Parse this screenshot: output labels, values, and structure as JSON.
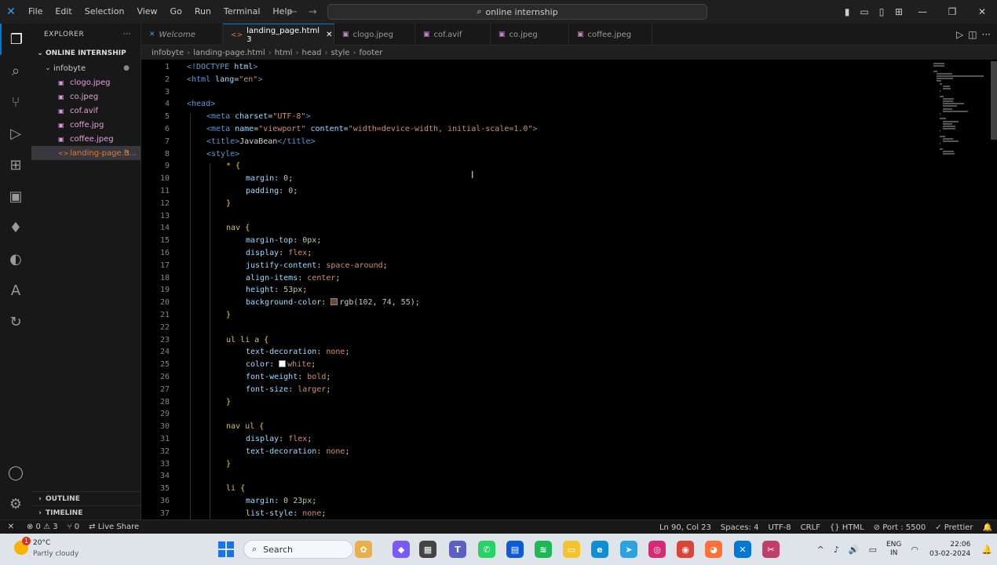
{
  "titlebar": {
    "menu": [
      "File",
      "Edit",
      "Selection",
      "View",
      "Go",
      "Run",
      "Terminal",
      "Help"
    ],
    "search_text": "online internship",
    "logo_glyph": "✕",
    "search_glyph": "⌕",
    "back_glyph": "←",
    "forward_glyph": "→",
    "layout_glyphs": [
      "▮",
      "▭",
      "▯",
      "⊞"
    ],
    "minimize_glyph": "—",
    "restore_glyph": "❐",
    "close_glyph": "✕"
  },
  "activity": {
    "icons": [
      "files-icon",
      "search-icon",
      "source-control-icon",
      "run-debug-icon",
      "extensions-icon",
      "remote-explorer-icon",
      "mongodb-icon",
      "edge-devtools-icon",
      "azure-icon",
      "live-share-icon",
      "accounts-icon",
      "manage-gear-icon"
    ],
    "glyphs": [
      "❐",
      "⌕",
      "⑂",
      "▷",
      "⊞",
      "▣",
      "♦",
      "◐",
      "A",
      "↻",
      "◯",
      "⚙"
    ]
  },
  "sidebar": {
    "header": "EXPLORER",
    "header_more": "···",
    "workspace": "ONLINE INTERNSHIP",
    "folder": "infobyte",
    "folder_dot": "●",
    "chev_open": "⌄",
    "chev_closed": "›",
    "files": [
      {
        "name": "clogo.jpeg",
        "icon": "▣"
      },
      {
        "name": "co.jpeg",
        "icon": "▣"
      },
      {
        "name": "cof.avif",
        "icon": "▣"
      },
      {
        "name": "coffe.jpg",
        "icon": "▣"
      },
      {
        "name": "coffee.jpeg",
        "icon": "▣"
      },
      {
        "name": "landing-page.h...",
        "icon": "<>",
        "badge": "3"
      }
    ],
    "outline": "OUTLINE",
    "timeline": "TIMELINE"
  },
  "tabs": [
    {
      "label": "Welcome",
      "icon": "✕"
    },
    {
      "label": "landing_page.html 3",
      "icon": "<>",
      "close": "✕"
    },
    {
      "label": "clogo.jpeg",
      "icon": "▣"
    },
    {
      "label": "cof.avif",
      "icon": "▣"
    },
    {
      "label": "co.jpeg",
      "icon": "▣"
    },
    {
      "label": "coffee.jpeg",
      "icon": "▣"
    }
  ],
  "tab_actions": {
    "run": "▷",
    "split": "◫",
    "more": "···"
  },
  "breadcrumb": {
    "items": [
      "infobyte",
      "landing-page.html",
      "html",
      "head",
      "style",
      "footer"
    ],
    "sep": "›"
  },
  "editor": {
    "lines": [
      {
        "n": "1",
        "tokens": [
          [
            "tag",
            "<!DOCTYPE "
          ],
          [
            "attr",
            "html"
          ],
          [
            "tag",
            ">"
          ]
        ]
      },
      {
        "n": "2",
        "tokens": [
          [
            "tag",
            "<html "
          ],
          [
            "attr",
            "lang"
          ],
          [
            "txt",
            "="
          ],
          [
            "str",
            "\"en\""
          ],
          [
            "tag",
            ">"
          ]
        ]
      },
      {
        "n": "3",
        "tokens": []
      },
      {
        "n": "4",
        "tokens": [
          [
            "tag",
            "<head>"
          ]
        ]
      },
      {
        "n": "5",
        "indent": 1,
        "tokens": [
          [
            "tag",
            "<meta "
          ],
          [
            "attr",
            "charset"
          ],
          [
            "txt",
            "="
          ],
          [
            "str",
            "\"UTF-8\""
          ],
          [
            "tag",
            ">"
          ]
        ]
      },
      {
        "n": "6",
        "indent": 1,
        "tokens": [
          [
            "tag",
            "<meta "
          ],
          [
            "attr",
            "name"
          ],
          [
            "txt",
            "="
          ],
          [
            "str",
            "\"viewport\" "
          ],
          [
            "attr",
            "content"
          ],
          [
            "txt",
            "="
          ],
          [
            "str",
            "\"width=device-width, initial-scale=1.0\""
          ],
          [
            "tag",
            ">"
          ]
        ]
      },
      {
        "n": "7",
        "indent": 1,
        "tokens": [
          [
            "tag",
            "<title>"
          ],
          [
            "txt",
            "JavaBean"
          ],
          [
            "tag",
            "</title>"
          ]
        ]
      },
      {
        "n": "8",
        "indent": 1,
        "tokens": [
          [
            "tag",
            "<style>"
          ]
        ]
      },
      {
        "n": "9",
        "indent": 2,
        "tokens": [
          [
            "sel",
            "* "
          ],
          [
            "brace",
            "{"
          ]
        ]
      },
      {
        "n": "10",
        "indent": 3,
        "tokens": [
          [
            "prop",
            "margin"
          ],
          [
            "txt",
            ": "
          ],
          [
            "num",
            "0"
          ],
          [
            "txt",
            ";"
          ]
        ]
      },
      {
        "n": "11",
        "indent": 3,
        "tokens": [
          [
            "prop",
            "padding"
          ],
          [
            "txt",
            ": "
          ],
          [
            "num",
            "0"
          ],
          [
            "txt",
            ";"
          ]
        ]
      },
      {
        "n": "12",
        "indent": 2,
        "tokens": [
          [
            "brace",
            "}"
          ]
        ]
      },
      {
        "n": "13",
        "tokens": []
      },
      {
        "n": "14",
        "indent": 2,
        "tokens": [
          [
            "sel",
            "nav "
          ],
          [
            "brace",
            "{"
          ]
        ]
      },
      {
        "n": "15",
        "indent": 3,
        "tokens": [
          [
            "prop",
            "margin-top"
          ],
          [
            "txt",
            ": "
          ],
          [
            "num",
            "0px"
          ],
          [
            "txt",
            ";"
          ]
        ]
      },
      {
        "n": "16",
        "indent": 3,
        "tokens": [
          [
            "prop",
            "display"
          ],
          [
            "txt",
            ": "
          ],
          [
            "val",
            "flex"
          ],
          [
            "txt",
            ";"
          ]
        ]
      },
      {
        "n": "17",
        "indent": 3,
        "tokens": [
          [
            "prop",
            "justify-content"
          ],
          [
            "txt",
            ": "
          ],
          [
            "val",
            "space-around"
          ],
          [
            "txt",
            ";"
          ]
        ]
      },
      {
        "n": "18",
        "indent": 3,
        "tokens": [
          [
            "prop",
            "align-items"
          ],
          [
            "txt",
            ": "
          ],
          [
            "val",
            "center"
          ],
          [
            "txt",
            ";"
          ]
        ]
      },
      {
        "n": "19",
        "indent": 3,
        "tokens": [
          [
            "prop",
            "height"
          ],
          [
            "txt",
            ": "
          ],
          [
            "num",
            "53px"
          ],
          [
            "txt",
            ";"
          ]
        ]
      },
      {
        "n": "20",
        "indent": 3,
        "swatch": "#664a37",
        "tokens": [
          [
            "prop",
            "background-color"
          ],
          [
            "txt",
            ": "
          ],
          [
            "swatch",
            ""
          ],
          [
            "txt",
            "rgb("
          ],
          [
            "num",
            "102"
          ],
          [
            "txt",
            ", "
          ],
          [
            "num",
            "74"
          ],
          [
            "txt",
            ", "
          ],
          [
            "num",
            "55"
          ],
          [
            "txt",
            ");"
          ]
        ]
      },
      {
        "n": "21",
        "indent": 2,
        "tokens": [
          [
            "brace",
            "}"
          ]
        ]
      },
      {
        "n": "22",
        "tokens": []
      },
      {
        "n": "23",
        "indent": 2,
        "tokens": [
          [
            "sel",
            "ul li a "
          ],
          [
            "brace",
            "{"
          ]
        ]
      },
      {
        "n": "24",
        "indent": 3,
        "tokens": [
          [
            "prop",
            "text-decoration"
          ],
          [
            "txt",
            ": "
          ],
          [
            "val",
            "none"
          ],
          [
            "txt",
            ";"
          ]
        ]
      },
      {
        "n": "25",
        "indent": 3,
        "swatch": "#ffffff",
        "tokens": [
          [
            "prop",
            "color"
          ],
          [
            "txt",
            ": "
          ],
          [
            "swatch",
            ""
          ],
          [
            "val",
            "white"
          ],
          [
            "txt",
            ";"
          ]
        ]
      },
      {
        "n": "26",
        "indent": 3,
        "tokens": [
          [
            "prop",
            "font-weight"
          ],
          [
            "txt",
            ": "
          ],
          [
            "val",
            "bold"
          ],
          [
            "txt",
            ";"
          ]
        ]
      },
      {
        "n": "27",
        "indent": 3,
        "tokens": [
          [
            "prop",
            "font-size"
          ],
          [
            "txt",
            ": "
          ],
          [
            "val",
            "larger"
          ],
          [
            "txt",
            ";"
          ]
        ]
      },
      {
        "n": "28",
        "indent": 2,
        "tokens": [
          [
            "brace",
            "}"
          ]
        ]
      },
      {
        "n": "29",
        "tokens": []
      },
      {
        "n": "30",
        "indent": 2,
        "tokens": [
          [
            "sel",
            "nav ul "
          ],
          [
            "brace",
            "{"
          ]
        ]
      },
      {
        "n": "31",
        "indent": 3,
        "tokens": [
          [
            "prop",
            "display"
          ],
          [
            "txt",
            ": "
          ],
          [
            "val",
            "flex"
          ],
          [
            "txt",
            ";"
          ]
        ]
      },
      {
        "n": "32",
        "indent": 3,
        "tokens": [
          [
            "prop",
            "text-decoration"
          ],
          [
            "txt",
            ": "
          ],
          [
            "val",
            "none"
          ],
          [
            "txt",
            ";"
          ]
        ]
      },
      {
        "n": "33",
        "indent": 2,
        "tokens": [
          [
            "brace",
            "}"
          ]
        ]
      },
      {
        "n": "34",
        "tokens": []
      },
      {
        "n": "35",
        "indent": 2,
        "tokens": [
          [
            "sel",
            "li "
          ],
          [
            "brace",
            "{"
          ]
        ]
      },
      {
        "n": "36",
        "indent": 3,
        "tokens": [
          [
            "prop",
            "margin"
          ],
          [
            "txt",
            ": "
          ],
          [
            "num",
            "0 23px"
          ],
          [
            "txt",
            ";"
          ]
        ]
      },
      {
        "n": "37",
        "indent": 3,
        "tokens": [
          [
            "prop",
            "list-style"
          ],
          [
            "txt",
            ": "
          ],
          [
            "val",
            "none"
          ],
          [
            "txt",
            ";"
          ]
        ]
      }
    ],
    "cursor_glyph": "I"
  },
  "statusbar": {
    "remote": "✕",
    "problems": "⊗ 0 ⚠ 3",
    "ports": "⑂ 0",
    "liveshare": "Live Share",
    "liveshare_icon": "⇄",
    "position": "Ln 90, Col 23",
    "spaces": "Spaces: 4",
    "encoding": "UTF-8",
    "eol": "CRLF",
    "language": "{} HTML",
    "port": "⊘ Port : 5500",
    "prettier": "✓ Prettier",
    "bell": "🔔"
  },
  "taskbar": {
    "weather_temp": "20°C",
    "weather_desc": "Partly cloudy",
    "weather_alert": "1",
    "search": "Search",
    "search_glyph": "⌕",
    "apps": [
      {
        "name": "widgets-app",
        "color": "#e8b04a",
        "glyph": "✿"
      },
      {
        "name": "copilot-app",
        "color": "#7a5af8",
        "glyph": "◆"
      },
      {
        "name": "file-manager-app",
        "color": "#444444",
        "glyph": "▦"
      },
      {
        "name": "teams-app",
        "color": "#5b5fc7",
        "glyph": "T"
      },
      {
        "name": "whatsapp-app",
        "color": "#25d366",
        "glyph": "✆"
      },
      {
        "name": "store-app",
        "color": "#0a5bd6",
        "glyph": "▤"
      },
      {
        "name": "spotify-app",
        "color": "#1db954",
        "glyph": "≋"
      },
      {
        "name": "explorer-app",
        "color": "#f4c430",
        "glyph": "▭"
      },
      {
        "name": "edge-app",
        "color": "#0c8fd4",
        "glyph": "e"
      },
      {
        "name": "telegram-app",
        "color": "#2aa3de",
        "glyph": "➤"
      },
      {
        "name": "instagram-app",
        "color": "#d62976",
        "glyph": "◎"
      },
      {
        "name": "chrome-app",
        "color": "#db4437",
        "glyph": "◉"
      },
      {
        "name": "firefox-app",
        "color": "#ff7139",
        "glyph": "◕"
      },
      {
        "name": "vscode-app",
        "color": "#0078d4",
        "glyph": "✕"
      },
      {
        "name": "snipping-app",
        "color": "#c43e6b",
        "glyph": "✂"
      }
    ],
    "tray_up": "^",
    "mic": "♪",
    "volume": "🔊",
    "battery": "▭",
    "lang_top": "ENG",
    "lang_bottom": "IN",
    "wifi": "◠",
    "time": "22:06",
    "date": "03-02-2024",
    "notif": "🔔"
  }
}
